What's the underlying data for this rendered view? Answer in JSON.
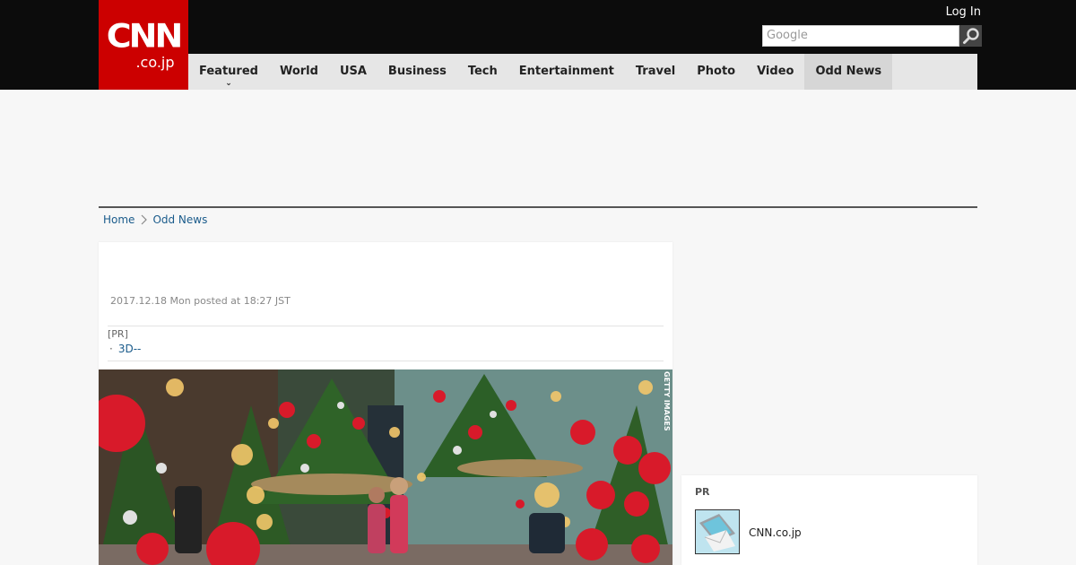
{
  "header": {
    "logo_line1": "CNN",
    "logo_line2": ".co.jp",
    "login_label": "Log In",
    "search_placeholder": "Google",
    "nav_items": [
      "Featured",
      "World",
      "USA",
      "Business",
      "Tech",
      "Entertainment",
      "Travel",
      "Photo",
      "Video",
      "Odd News"
    ],
    "active_nav": "Odd News"
  },
  "breadcrumb": {
    "home": "Home",
    "current": "Odd News"
  },
  "article": {
    "date": "2017.12.18 Mon posted at 18:27 JST",
    "pr_label": "[PR]",
    "pr_link": "3D--",
    "photo_credit": "GETTY IMAGES"
  },
  "sidebar": {
    "pr_title": "PR",
    "pr_item_text": "CNN.co.jp"
  },
  "colors": {
    "brand_red": "#cc0000",
    "link_blue": "#1a5b8b"
  }
}
